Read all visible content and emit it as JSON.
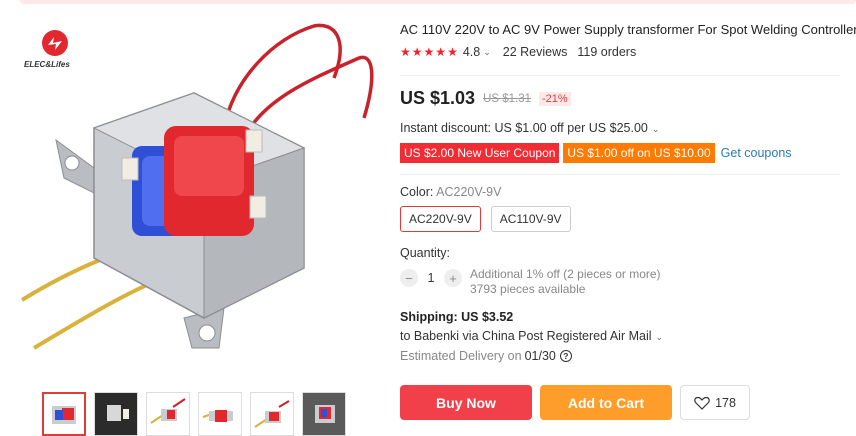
{
  "gallery": {
    "logo_text": "ELEC&Lifes",
    "watermark": "ELEC&Lifes",
    "thumbnails": [
      {
        "label": "thumbnail-1",
        "active": true
      },
      {
        "label": "thumbnail-2",
        "active": false
      },
      {
        "label": "thumbnail-3",
        "active": false
      },
      {
        "label": "thumbnail-4",
        "active": false
      },
      {
        "label": "thumbnail-5",
        "active": false
      },
      {
        "label": "thumbnail-6",
        "active": false
      }
    ]
  },
  "product": {
    "title": "AC 110V 220V to AC 9V Power Supply transformer For Spot Welding Controller",
    "rating": "4.8",
    "reviews": "22 Reviews",
    "orders": "119 orders",
    "price": "US $1.03",
    "original_price": "US $1.31",
    "discount": "-21%",
    "instant_discount": "Instant discount: US $1.00 off per US $25.00",
    "coupons": [
      "US $2.00 New User Coupon",
      "US $1.00 off on US $10.00"
    ],
    "get_coupons": "Get coupons",
    "color_label": "Color:",
    "color_selected": "AC220V-9V",
    "color_options": [
      "AC220V-9V",
      "AC110V-9V"
    ],
    "quantity_label": "Quantity:",
    "quantity": "1",
    "quantity_minus": "−",
    "quantity_plus": "+",
    "additional_discount": "Additional 1% off (2 pieces or more)",
    "pieces_available": "3793 pieces available",
    "shipping_label": "Shipping:",
    "shipping_price": "US $3.52",
    "shipping_method": "to Babenki via China Post Registered Air Mail",
    "delivery_label": "Estimated Delivery on",
    "delivery_date": "01/30",
    "help_glyph": "?",
    "buy_now": "Buy Now",
    "add_to_cart": "Add to Cart",
    "wishlist_count": "178"
  },
  "colors": {
    "accent_red": "#f2404b",
    "accent_orange": "#ff9d2a",
    "coupon_red": "#f02d34",
    "coupon_orange": "#ff7a00",
    "link_blue": "#2a7ab8",
    "star_red": "#f5222d"
  },
  "icons": [
    "star-icon",
    "chevron-down-icon",
    "help-icon",
    "heart-icon",
    "logo-icon"
  ]
}
